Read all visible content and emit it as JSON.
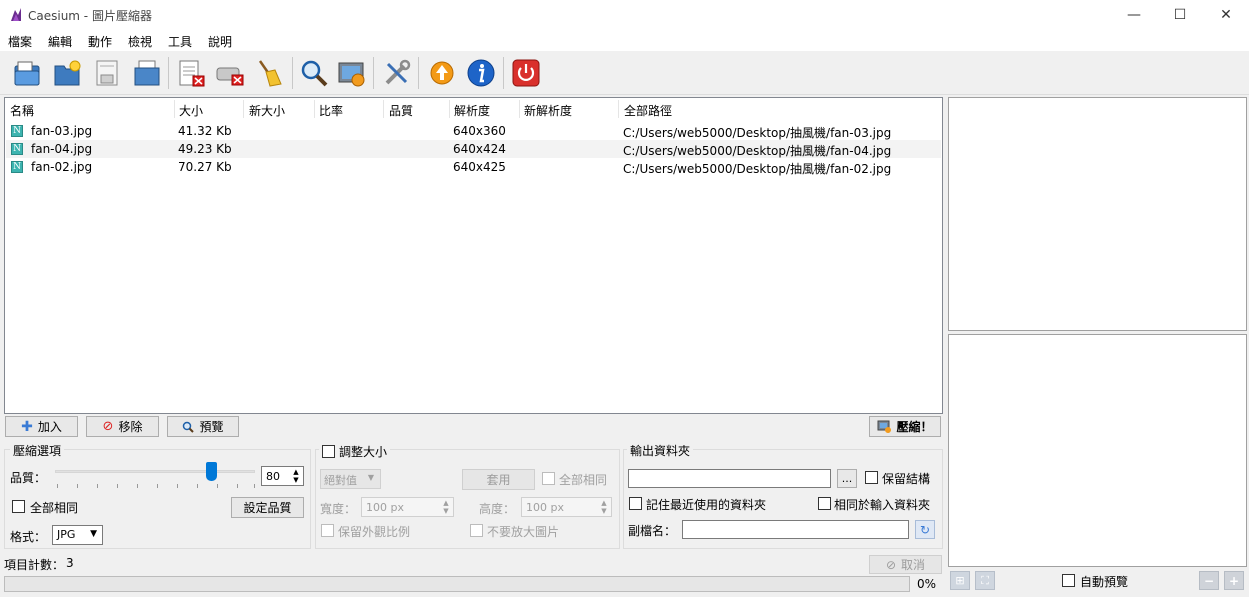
{
  "window": {
    "title": "Caesium - 圖片壓縮器",
    "minimize_glyph": "—",
    "maximize_glyph": "☐",
    "close_glyph": "✕"
  },
  "menu": [
    "檔案",
    "編輯",
    "動作",
    "檢視",
    "工具",
    "說明"
  ],
  "toolbar": {
    "icons": [
      "add-pictures-icon",
      "add-folder-icon",
      "save-list-icon",
      "open-list-icon",
      "remove-item-icon",
      "remove-all-icon",
      "clear-list-icon",
      "search-icon",
      "preview-image-icon",
      "settings-tools-icon",
      "update-icon",
      "info-icon",
      "power-icon"
    ]
  },
  "file_list": {
    "columns": [
      "名稱",
      "大小",
      "新大小",
      "比率",
      "品質",
      "解析度",
      "新解析度",
      "全部路徑"
    ],
    "rows": [
      {
        "icon": "N",
        "name": "fan-03.jpg",
        "size": "41.32 Kb",
        "new_size": "",
        "ratio": "",
        "quality": "",
        "resolution": "640x360",
        "new_resolution": "",
        "path": "C:/Users/web5000/Desktop/抽風機/fan-03.jpg"
      },
      {
        "icon": "N",
        "name": "fan-04.jpg",
        "size": "49.23 Kb",
        "new_size": "",
        "ratio": "",
        "quality": "",
        "resolution": "640x424",
        "new_resolution": "",
        "path": "C:/Users/web5000/Desktop/抽風機/fan-04.jpg"
      },
      {
        "icon": "N",
        "name": "fan-02.jpg",
        "size": "70.27 Kb",
        "new_size": "",
        "ratio": "",
        "quality": "",
        "resolution": "640x425",
        "new_resolution": "",
        "path": "C:/Users/web5000/Desktop/抽風機/fan-02.jpg"
      }
    ]
  },
  "actions": {
    "add_label": "加入",
    "remove_label": "移除",
    "preview_label": "預覽",
    "compress_label": "壓縮！"
  },
  "compression": {
    "title": "壓縮選項",
    "quality_label": "品質：",
    "quality_value": "80",
    "quality_level": 0.8,
    "same_for_all_label": "全部相同",
    "set_quality_label": "設定品質",
    "format_label": "格式：",
    "format_value": "JPG"
  },
  "resize": {
    "title": "調整大小",
    "mode_value": "絕對值",
    "apply_label": "套用",
    "same_for_all_label": "全部相同",
    "width_label": "寬度：",
    "width_value": "100 px",
    "height_label": "高度：",
    "height_value": "100 px",
    "keep_ratio_label": "保留外觀比例",
    "no_enlarge_label": "不要放大圖片"
  },
  "output": {
    "title": "輸出資料夾",
    "folder_value": "",
    "browse_label": "...",
    "keep_structure_label": "保留結構",
    "remember_last_label": "記住最近使用的資料夾",
    "same_as_input_label": "相同於輸入資料夾",
    "suffix_label": "副檔名：",
    "suffix_value": ""
  },
  "status": {
    "item_count_label": "項目計數：",
    "item_count": "3",
    "cancel_label": "取消",
    "progress_text": "0%",
    "progress": 0
  },
  "preview_panel": {
    "auto_preview_label": "自動預覽"
  },
  "colors": {
    "accent": "#0078d7",
    "power_red": "#d9302c",
    "info_blue": "#1e64c8"
  }
}
